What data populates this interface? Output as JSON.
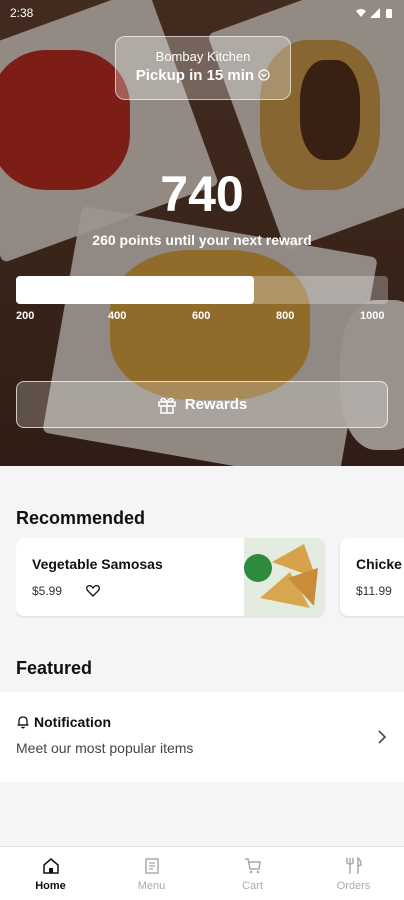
{
  "status_bar": {
    "time": "2:38",
    "icons": [
      "wifi-icon",
      "signal-icon",
      "battery-icon"
    ]
  },
  "store": {
    "name": "Bombay Kitchen",
    "pickup": "Pickup in 15 min"
  },
  "loyalty": {
    "points": "740",
    "subtitle": "260 points until your next reward",
    "progress_fraction": 0.64,
    "ticks": [
      "200",
      "400",
      "600",
      "800",
      "1000"
    ],
    "rewards_button": "Rewards"
  },
  "recommended": {
    "title": "Recommended",
    "items": [
      {
        "name": "Vegetable Samosas",
        "price": "$5.99"
      },
      {
        "name": "Chicke",
        "price": "$11.99"
      }
    ]
  },
  "featured": {
    "title": "Featured",
    "notification": {
      "title": "Notification",
      "subtitle": "Meet our most popular items"
    }
  },
  "tabs": [
    {
      "label": "Home",
      "icon": "home-icon",
      "active": true
    },
    {
      "label": "Menu",
      "icon": "menu-icon",
      "active": false
    },
    {
      "label": "Cart",
      "icon": "cart-icon",
      "active": false
    },
    {
      "label": "Orders",
      "icon": "orders-icon",
      "active": false
    }
  ],
  "colors": {
    "text": "#111111",
    "muted": "#aaaaaa",
    "hero_overlay": "#3b241a"
  }
}
